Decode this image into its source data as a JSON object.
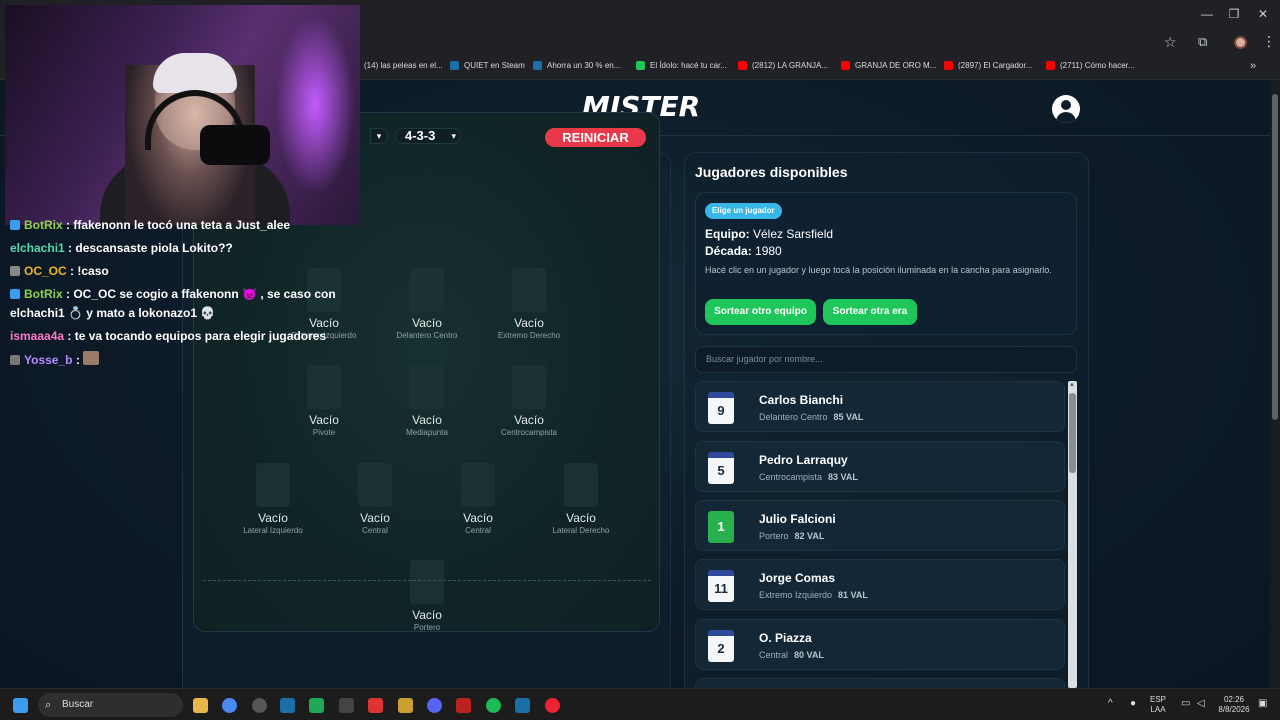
{
  "browser": {
    "window_controls": {
      "minimize": "—",
      "restore": "❐",
      "close": "✕"
    },
    "bookmarks": [
      {
        "label": "(14) las peleas en el...",
        "icon": "youtube-icon",
        "color": "#ff0000"
      },
      {
        "label": "QUIET en Steam",
        "icon": "steam-icon",
        "color": "#1b6fa8"
      },
      {
        "label": "Ahorra un 30 % en...",
        "icon": "steam-icon",
        "color": "#1b6fa8"
      },
      {
        "label": "El Ídolo: hacé tu car...",
        "icon": "idolo-icon",
        "color": "#1fc65a"
      },
      {
        "label": "(2812) LA GRANJA...",
        "icon": "youtube-icon",
        "color": "#ff0000"
      },
      {
        "label": "GRANJA DE ORO M...",
        "icon": "youtube-icon",
        "color": "#ff0000"
      },
      {
        "label": "(2897) El Cargador...",
        "icon": "youtube-icon",
        "color": "#ff0000"
      },
      {
        "label": "(2711) Cómo hacer...",
        "icon": "youtube-icon",
        "color": "#ff0000"
      }
    ],
    "more": "»"
  },
  "site": {
    "logo": "MISTER"
  },
  "pitch": {
    "formation": "4-3-3",
    "reset_label": "REINICIAR",
    "empty_label": "Vacío",
    "slots": [
      {
        "position": "Extremo Izquierdo",
        "label": "Vacío"
      },
      {
        "position": "Delantero Centro",
        "label": "Vacío"
      },
      {
        "position": "Extremo Derecho",
        "label": "Vacío"
      },
      {
        "position": "Pivote",
        "label": "Vacío"
      },
      {
        "position": "Mediapunta",
        "label": "Vacío"
      },
      {
        "position": "Centrocampista",
        "label": "Vacío"
      },
      {
        "position": "Lateral Izquierdo",
        "label": "Vacío"
      },
      {
        "position": "Central",
        "label": "Vacío"
      },
      {
        "position": "Central",
        "label": "Vacío"
      },
      {
        "position": "Lateral Derecho",
        "label": "Vacío"
      },
      {
        "position": "Portero",
        "label": "Vacío"
      }
    ]
  },
  "available": {
    "title": "Jugadores disponibles",
    "pill": "Elige un jugador",
    "team_label": "Equipo:",
    "team_value": "Vélez Sarsfield",
    "decade_label": "Década:",
    "decade_value": "1980",
    "hint": "Hacé clic en un jugador y luego tocá la posición iluminada en la cancha para asignarlo.",
    "btn_team": "Sortear otro equipo",
    "btn_era": "Sortear otra era",
    "search_placeholder": "Buscar jugador por nombre...",
    "players": [
      {
        "number": "9",
        "name": "Carlos Bianchi",
        "position": "Delantero Centro",
        "val": "85 VAL",
        "kit": "white"
      },
      {
        "number": "5",
        "name": "Pedro Larraquy",
        "position": "Centrocampista",
        "val": "83 VAL",
        "kit": "white"
      },
      {
        "number": "1",
        "name": "Julio Falcioni",
        "position": "Portero",
        "val": "82 VAL",
        "kit": "green"
      },
      {
        "number": "11",
        "name": "Jorge Comas",
        "position": "Extremo Izquierdo",
        "val": "81 VAL",
        "kit": "white"
      },
      {
        "number": "2",
        "name": "O. Piazza",
        "position": "Central",
        "val": "80 VAL",
        "kit": "white"
      }
    ]
  },
  "chat": [
    {
      "user": "BotRix",
      "msg": ": ffakenonn le tocó una teta a Just_alee",
      "color": "#8fd14f",
      "icon": "bot-icon"
    },
    {
      "user": "elchachi1",
      "msg": ": descansaste piola Lokito??",
      "color": "#5ad6b0",
      "icon": ""
    },
    {
      "user": "OC_OC",
      "msg": ": !caso",
      "color": "#f0b429",
      "icon": "keyboard-icon"
    },
    {
      "user": "BotRix",
      "msg": ": OC_OC se cogio a ffakenonn 👿 , se caso con",
      "color": "#8fd14f",
      "icon": "bot-icon"
    },
    {
      "user": "",
      "msg": "elchachi1 💍 y mato a lokonazo1 💀",
      "color": "#ffffff",
      "icon": ""
    },
    {
      "user": "ismaaa4a",
      "msg": ": te va tocando equipos para elegir jugadores",
      "color": "#ff7ac6",
      "icon": ""
    },
    {
      "user": "Yosse_b",
      "msg": ":",
      "color": "#b48cff",
      "icon": "ghost-icon"
    }
  ],
  "taskbar": {
    "search": "Buscar",
    "lang_top": "ESP",
    "lang_bottom": "LAA",
    "time": "02:26",
    "date": "8/8/2026"
  }
}
